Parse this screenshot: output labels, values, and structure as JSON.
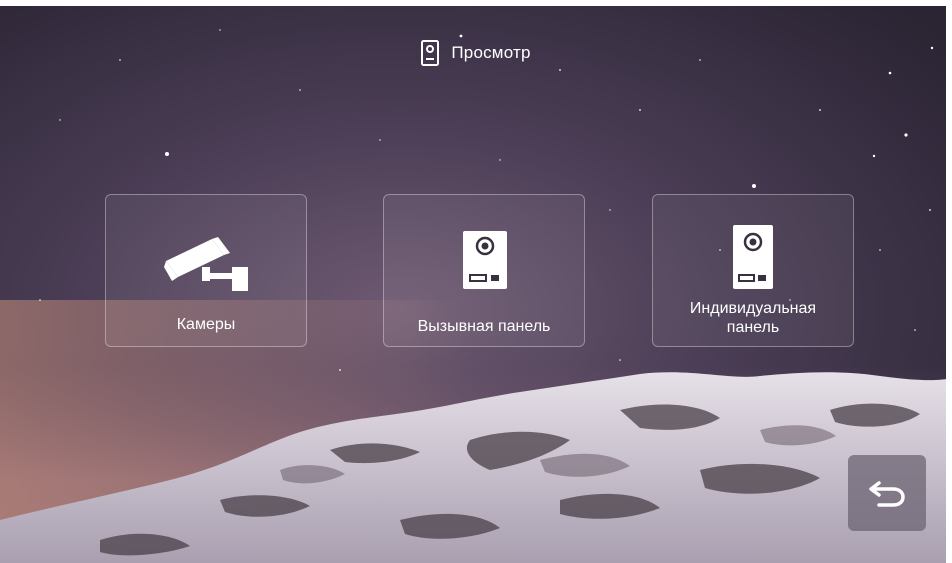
{
  "header": {
    "icon": "door-panel-icon",
    "title": "Просмотр"
  },
  "tiles": [
    {
      "icon": "security-camera-icon",
      "label": "Камеры"
    },
    {
      "icon": "call-panel-icon",
      "label": "Вызывная панель"
    },
    {
      "icon": "individual-panel-icon",
      "label_line1": "Индивидуальная",
      "label_line2": "панель"
    }
  ],
  "back_button": {
    "icon": "back-arrow-icon"
  },
  "colors": {
    "sky_top": "#2c2634",
    "sky_mid": "#5a4a62",
    "horizon_glow": "#a07a86",
    "snow": "#d8d2dc",
    "accent_white": "#ffffff"
  }
}
